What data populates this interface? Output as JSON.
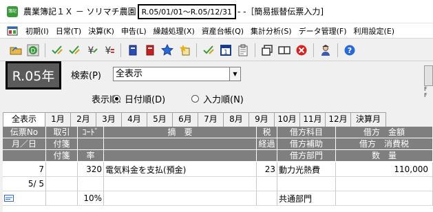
{
  "window": {
    "title_prefix": "農業簿記１Ｘ － ソリマチ農園",
    "period": "R.05/01/01～R.05/12/31",
    "title_suffix": "- -［簡易振替伝票入力]",
    "icon_text": "簿記"
  },
  "menu": {
    "items": [
      "初期(I)",
      "日常(T)",
      "決算(K)",
      "申告(L)",
      "繰越処理(X)",
      "資産台帳(Q)",
      "集計分析(S)",
      "データ管理(F)",
      "利用設定(E)"
    ]
  },
  "toolbar": {
    "icons": [
      "open-folder-icon",
      "d-circle-icon",
      "check-pen-icon",
      "check-pen-icon",
      "yen-icon",
      "yen-icon",
      "blue-book-icon",
      "red-book-icon",
      "star-icon",
      "star-doc-icon",
      "check-pen-icon",
      "calendar-1-icon",
      "clipboard-icon",
      "copy-window-icon",
      "double-window-icon",
      "close-red-icon",
      "person-icon",
      "help-icon"
    ]
  },
  "year_label": "R.05年",
  "search": {
    "label": "検索(P)",
    "value": "全表示"
  },
  "order": {
    "label": "表示順:",
    "options": [
      {
        "label": "日付順(D)",
        "selected": true
      },
      {
        "label": "入力順(N)",
        "selected": false
      }
    ]
  },
  "right_panel": {
    "labels": [
      "F",
      "F"
    ]
  },
  "tabs": [
    "全表示",
    "1月",
    "2月",
    "3月",
    "4月",
    "5月",
    "6月",
    "7月",
    "8月",
    "9月",
    "10月",
    "11月",
    "12月",
    "決算月"
  ],
  "active_tab": 0,
  "grid": {
    "headers": {
      "col1": [
        "伝票No",
        "月／日"
      ],
      "col2": [
        "取引",
        "付箋",
        "付箋"
      ],
      "col3": [
        "ｺｰﾄﾞ",
        "",
        "率"
      ],
      "col4": [
        "摘　要"
      ],
      "col5": [
        "税",
        "経過"
      ],
      "col6": [
        "借方科目",
        "借方補助",
        "借方部門"
      ],
      "col7": [
        "借方　金額",
        "借方　消費税",
        "数　量"
      ]
    },
    "rows": [
      {
        "no": "7",
        "date": "5/ 5",
        "code": "320",
        "rate": "10%",
        "summary": "電気料金を支払(預金)",
        "tax": "23",
        "debit_account": "動力光熱費",
        "debit_dept": "共通部門",
        "amount": "110,000"
      }
    ]
  }
}
